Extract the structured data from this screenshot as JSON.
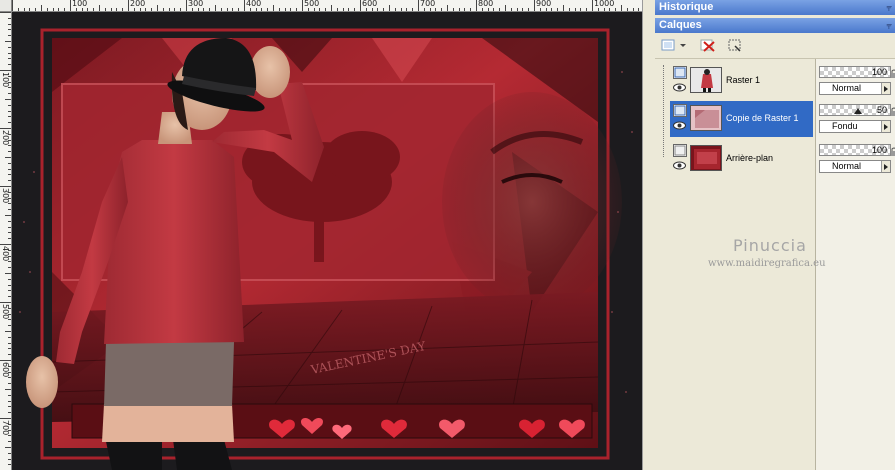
{
  "rulers": {
    "top_labels": [
      "100",
      "200",
      "300",
      "400",
      "500",
      "600",
      "700",
      "800",
      "900",
      "1000"
    ],
    "left_labels": [
      "100",
      "200",
      "300",
      "400",
      "500",
      "600",
      "700"
    ]
  },
  "canvas": {
    "artwork_text": "VALENTINE'S DAY",
    "colors": {
      "background": "#1a1a1c",
      "accent_red": "#b5222c",
      "frame_red": "#9c1d26"
    }
  },
  "palettes": {
    "history": {
      "title": "Historique",
      "pin_icon": "pin-icon"
    },
    "layers": {
      "title": "Calques",
      "pin_icon": "pin-icon",
      "layers": [
        {
          "name": "Raster 1",
          "opacity": "100",
          "blend": "Normal",
          "selected": false
        },
        {
          "name": "Copie de Raster 1",
          "opacity": "50",
          "blend": "Fondu",
          "selected": true
        },
        {
          "name": "Arrière-plan",
          "opacity": "100",
          "blend": "Normal",
          "selected": false
        }
      ]
    }
  },
  "watermark": {
    "title": "Pinuccia",
    "url": "www.maidiregrafica.eu"
  }
}
